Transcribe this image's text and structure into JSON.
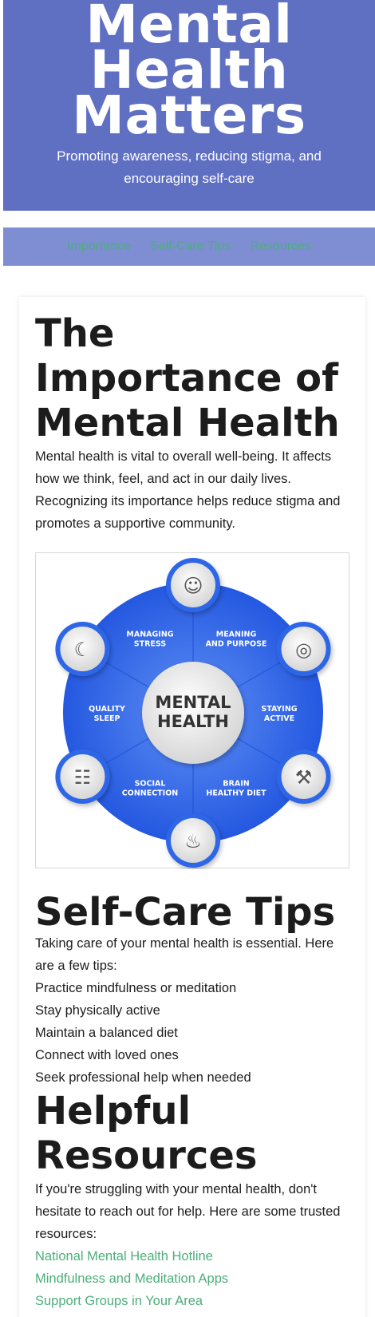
{
  "header": {
    "title_lines": [
      "Mental",
      "Health",
      "Matters"
    ],
    "subtitle": "Promoting awareness, reducing stigma, and encouraging self-care"
  },
  "nav": {
    "items": [
      "Importance",
      "Self-Care Tips",
      "Resources"
    ]
  },
  "importance": {
    "heading": "The Importance of Mental Health",
    "body": "Mental health is vital to overall well-being. It affects how we think, feel, and act in our daily lives. Recognizing its importance helps reduce stigma and promotes a supportive community."
  },
  "infographic": {
    "center_lines": [
      "MENTAL",
      "HEALTH"
    ],
    "segments": [
      {
        "lines": [
          "MANAGING",
          "STRESS"
        ]
      },
      {
        "lines": [
          "MEANING",
          "AND PURPOSE"
        ]
      },
      {
        "lines": [
          "STAYING",
          "ACTIVE"
        ]
      },
      {
        "lines": [
          "BRAIN",
          "HEALTHY DIET"
        ]
      },
      {
        "lines": [
          "SOCIAL",
          "CONNECTION"
        ]
      },
      {
        "lines": [
          "QUALITY",
          "SLEEP"
        ]
      }
    ],
    "icons": [
      "speedometer-smile-icon",
      "target-dart-icon",
      "dumbbell-icon",
      "apple-bottle-icon",
      "people-chat-icon",
      "moon-cloud-icon"
    ],
    "colors": {
      "ring": "#2f66e8",
      "ring_light": "#4a7df0",
      "center": "#ececec",
      "text": "#ffffff",
      "center_text": "#333333"
    }
  },
  "selfcare": {
    "heading": "Self-Care Tips",
    "intro": "Taking care of your mental health is essential. Here are a few tips:",
    "tips": [
      "Practice mindfulness or meditation",
      "Stay physically active",
      "Maintain a balanced diet",
      "Connect with loved ones",
      "Seek professional help when needed"
    ]
  },
  "resources": {
    "heading_lines": [
      "Helpful",
      "Resources"
    ],
    "intro": "If you're struggling with your mental health, don't hesitate to reach out for help. Here are some trusted resources:",
    "links": [
      "National Mental Health Hotline",
      "Mindfulness and Meditation Apps",
      "Support Groups in Your Area"
    ]
  },
  "colors": {
    "header_bg": "#5f6fc2",
    "nav_bg": "#7f8ed3",
    "link": "#4cae7a"
  }
}
